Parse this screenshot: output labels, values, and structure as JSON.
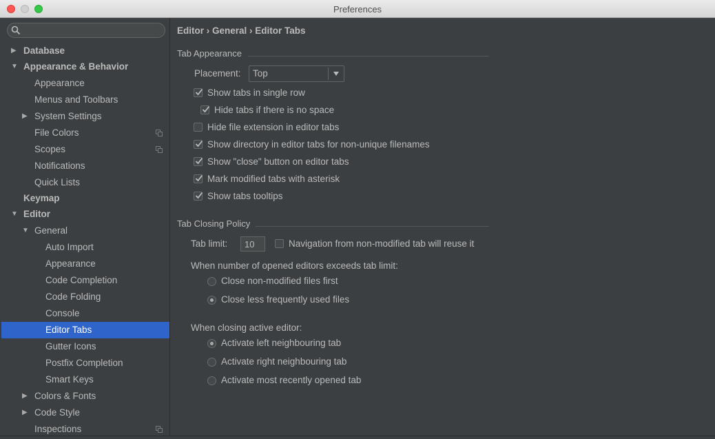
{
  "window": {
    "title": "Preferences"
  },
  "search": {
    "placeholder": ""
  },
  "sidebar": {
    "items": [
      {
        "label": "Database",
        "arrow": "▶"
      },
      {
        "label": "Appearance & Behavior",
        "arrow": "▼"
      },
      {
        "label": "Appearance"
      },
      {
        "label": "Menus and Toolbars"
      },
      {
        "label": "System Settings",
        "arrow": "▶"
      },
      {
        "label": "File Colors"
      },
      {
        "label": "Scopes"
      },
      {
        "label": "Notifications"
      },
      {
        "label": "Quick Lists"
      },
      {
        "label": "Keymap"
      },
      {
        "label": "Editor",
        "arrow": "▼"
      },
      {
        "label": "General",
        "arrow": "▼"
      },
      {
        "label": "Auto Import"
      },
      {
        "label": "Appearance"
      },
      {
        "label": "Code Completion"
      },
      {
        "label": "Code Folding"
      },
      {
        "label": "Console"
      },
      {
        "label": "Editor Tabs"
      },
      {
        "label": "Gutter Icons"
      },
      {
        "label": "Postfix Completion"
      },
      {
        "label": "Smart Keys"
      },
      {
        "label": "Colors & Fonts",
        "arrow": "▶"
      },
      {
        "label": "Code Style",
        "arrow": "▶"
      },
      {
        "label": "Inspections"
      }
    ]
  },
  "content": {
    "breadcrumb": "Editor › General › Editor Tabs",
    "tab_appearance": {
      "title": "Tab Appearance",
      "placement_label": "Placement:",
      "placement_value": "Top",
      "options": [
        {
          "label": "Show tabs in single row",
          "checked": true
        },
        {
          "label": "Hide tabs if there is no space",
          "checked": true
        },
        {
          "label": "Hide file extension in editor tabs",
          "checked": false
        },
        {
          "label": "Show directory in editor tabs for non-unique filenames",
          "checked": true
        },
        {
          "label": "Show \"close\" button on editor tabs",
          "checked": true
        },
        {
          "label": "Mark modified tabs with asterisk",
          "checked": true
        },
        {
          "label": "Show tabs tooltips",
          "checked": true
        }
      ]
    },
    "tab_closing": {
      "title": "Tab Closing Policy",
      "tab_limit_label": "Tab limit:",
      "tab_limit_value": "10",
      "reuse_label": "Navigation from non-modified tab will reuse it",
      "reuse_checked": false,
      "exceeds_label": "When number of opened editors exceeds tab limit:",
      "exceeds_options": [
        {
          "label": "Close non-modified files first",
          "checked": false
        },
        {
          "label": "Close less frequently used files",
          "checked": true
        }
      ],
      "closing_label": "When closing active editor:",
      "closing_options": [
        {
          "label": "Activate left neighbouring tab",
          "checked": true
        },
        {
          "label": "Activate right neighbouring tab",
          "checked": false
        },
        {
          "label": "Activate most recently opened tab",
          "checked": false
        }
      ]
    }
  },
  "colors": {
    "background": "#3c3f41",
    "selection": "#2f65ca",
    "text": "#bbbbbb"
  }
}
